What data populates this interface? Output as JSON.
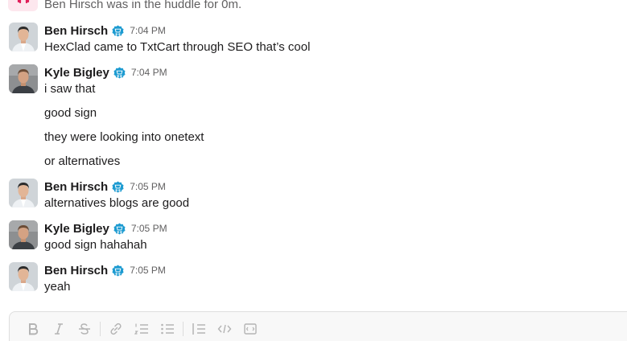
{
  "huddle": {
    "text": "Ben Hirsch was in the huddle for 0m."
  },
  "messages": [
    {
      "sender": "Ben Hirsch",
      "time": "7:04 PM",
      "avatar": "ben",
      "lines": [
        "HexClad came to TxtCart through SEO that’s cool"
      ]
    },
    {
      "sender": "Kyle Bigley",
      "time": "7:04 PM",
      "avatar": "kyle",
      "lines": [
        "i saw that",
        "good sign",
        "they were looking into onetext",
        "or alternatives"
      ]
    },
    {
      "sender": "Ben Hirsch",
      "time": "7:05 PM",
      "avatar": "ben",
      "lines": [
        "alternatives blogs are good"
      ]
    },
    {
      "sender": "Kyle Bigley",
      "time": "7:05 PM",
      "avatar": "kyle",
      "lines": [
        "good sign hahahah"
      ]
    },
    {
      "sender": "Ben Hirsch",
      "time": "7:05 PM",
      "avatar": "ben",
      "lines": [
        "yeah"
      ]
    }
  ],
  "composer": {
    "tools": [
      "bold-icon",
      "italic-icon",
      "strikethrough-icon",
      "link-icon",
      "ordered-list-icon",
      "bulleted-list-icon",
      "blockquote-icon",
      "code-icon",
      "code-block-icon"
    ]
  },
  "colors": {
    "badge": "#1d9bd1",
    "muted": "#616061",
    "text": "#1d1c1d"
  }
}
